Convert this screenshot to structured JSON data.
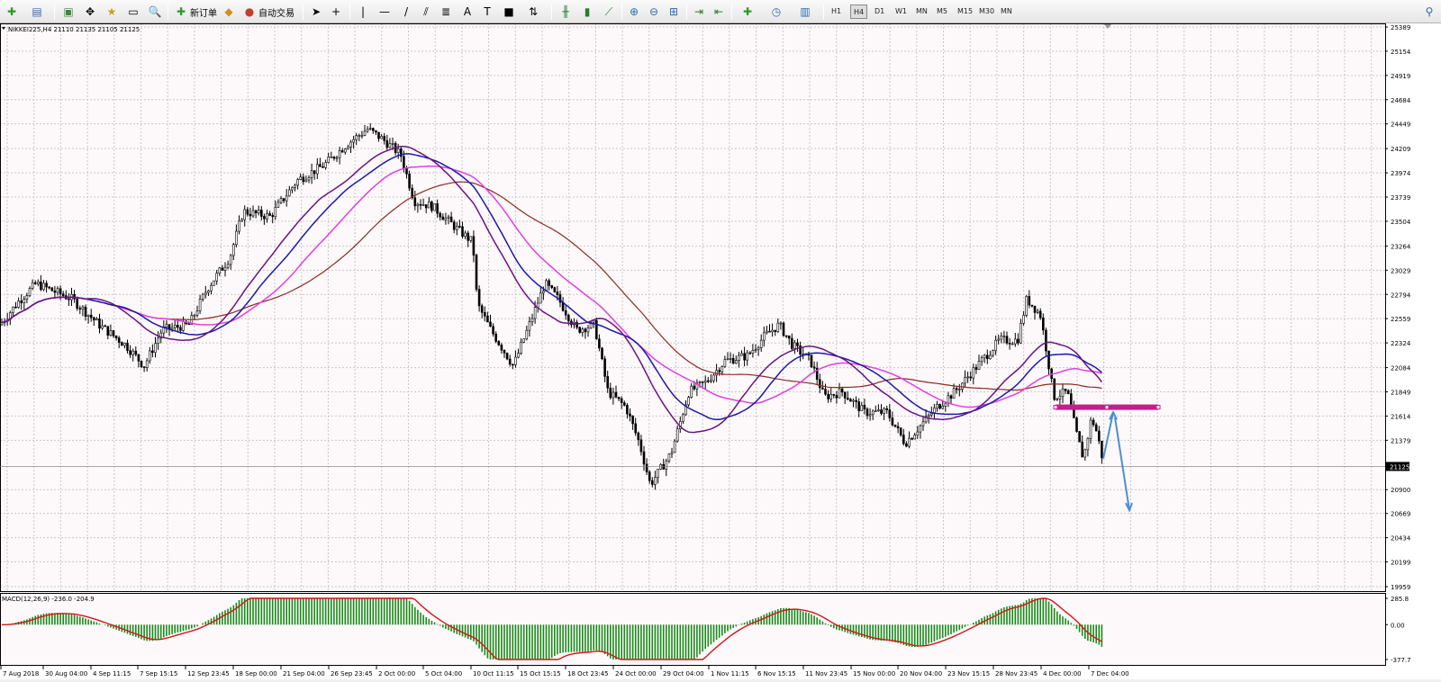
{
  "toolbar": {
    "new_order_label": "新订单",
    "auto_trading_label": "自动交易",
    "timeframes": [
      "H1",
      "H4",
      "D1",
      "W1",
      "MN",
      "M5",
      "M15",
      "M30",
      "MN"
    ],
    "active_timeframe": "H4"
  },
  "chart": {
    "header": "NIKKEI225,H4  21110 21135 21105 21125",
    "price_labels": [
      "25389",
      "25154",
      "24919",
      "24684",
      "24449",
      "24209",
      "23974",
      "23739",
      "23504",
      "23264",
      "23029",
      "22794",
      "22559",
      "22324",
      "22084",
      "21849",
      "21614",
      "21379",
      "20900",
      "20669",
      "20434",
      "20199",
      "19959"
    ],
    "current_price": "21125",
    "macd_header": "MACD(12,26,9) -236.0 -204.9",
    "macd_labels": [
      "285.8",
      "0.00",
      "-377.7"
    ],
    "time_labels": [
      "7 Aug 2018",
      "30 Aug 04:00",
      "4 Sep 11:15",
      "7 Sep 15:15",
      "12 Sep 23:45",
      "18 Sep 00:00",
      "21 Sep 04:00",
      "26 Sep 23:45",
      "2 Oct 00:00",
      "5 Oct 04:00",
      "10 Oct 11:15",
      "15 Oct 15:15",
      "18 Oct 23:45",
      "24 Oct 00:00",
      "29 Oct 04:00",
      "1 Nov 11:15",
      "6 Nov 15:15",
      "11 Nov 23:45",
      "15 Nov 00:00",
      "20 Nov 04:00",
      "23 Nov 15:15",
      "28 Nov 23:45",
      "4 Dec 00:00",
      "7 Dec 04:00"
    ]
  },
  "colors": {
    "bg": "#fdf8fa",
    "grid": "#c8c8c8",
    "candle": "#000000",
    "ma_purple": "#6a1580",
    "ma_blue": "#1a1aa8",
    "ma_magenta": "#e040e0",
    "ma_brown": "#8b2a22",
    "macd_hist": "#1a8a1a",
    "macd_signal": "#d01818",
    "level": "#c0208a",
    "arrow": "#4a90d0"
  },
  "chart_data": {
    "type": "candlestick",
    "symbol": "NIKKEI225",
    "timeframe": "H4",
    "quote": {
      "open": 21110,
      "high": 21135,
      "low": 21105,
      "close": 21125
    },
    "y_range": [
      19959,
      25389
    ],
    "key_prices": [
      {
        "date": "7 Aug 2018",
        "close": 22500
      },
      {
        "date": "7 Sep 15:15",
        "close": 22150
      },
      {
        "date": "2 Oct 00:00",
        "close": 24270
      },
      {
        "date": "10 Oct 11:15",
        "close": 22800
      },
      {
        "date": "24 Oct 00:00",
        "close": 21050
      },
      {
        "date": "6 Nov 15:15",
        "close": 22500
      },
      {
        "date": "20 Nov 04:00",
        "close": 21600
      },
      {
        "date": "28 Nov 23:45",
        "close": 22700
      },
      {
        "date": "7 Dec 04:00",
        "close": 21125
      }
    ],
    "macd": {
      "params": "12,26,9",
      "value": -236.0,
      "signal": -204.9,
      "y_range": [
        -377.7,
        285.8
      ]
    }
  }
}
